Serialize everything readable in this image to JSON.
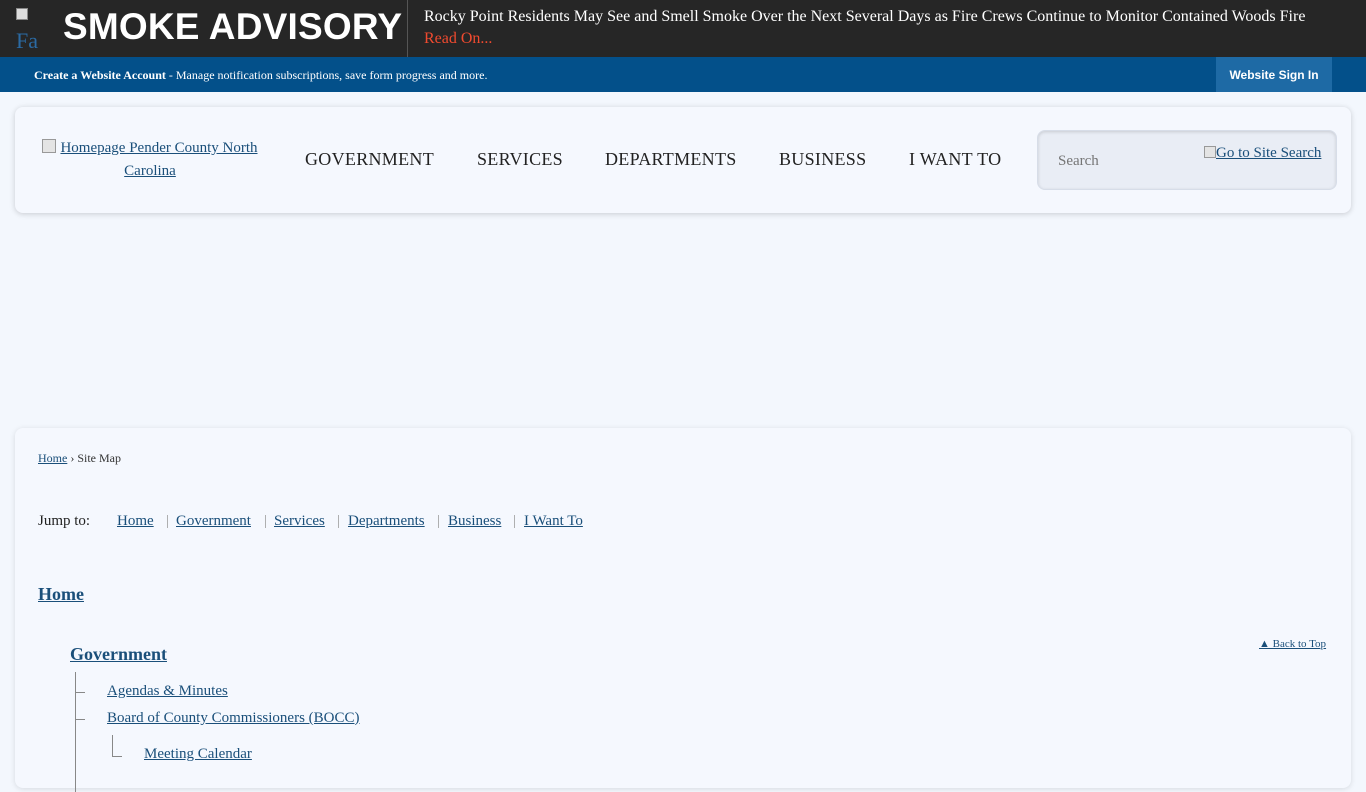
{
  "alert": {
    "icon": "alert-image-icon",
    "icon_alt": "Fa",
    "title": "SMOKE ADVISORY",
    "headline": "Rocky Point Residents May See and Smell Smoke Over the Next Several Days as Fire Crews Continue to Monitor Contained Woods Fire",
    "read_on": "Read On..."
  },
  "account_bar": {
    "create_label": "Create a Website Account",
    "create_desc": " - Manage notification subscriptions, save form progress and more.",
    "signin_label": "Website Sign In"
  },
  "header": {
    "logo_text": "Homepage Pender County North Carolina",
    "nav": [
      "GOVERNMENT",
      "SERVICES",
      "DEPARTMENTS",
      "BUSINESS",
      "I WANT TO"
    ],
    "search_placeholder": "Search",
    "search_button": "Go to Site Search"
  },
  "breadcrumb": {
    "home": "Home",
    "sep": " › ",
    "current": "Site Map"
  },
  "jump": {
    "label": "Jump to:",
    "links": [
      "Home",
      "Government",
      "Services",
      "Departments",
      "Business",
      "I Want To"
    ]
  },
  "sitemap": {
    "home": "Home",
    "government": "Government",
    "back_to_top": "▲ Back to Top",
    "items": [
      "Agendas & Minutes",
      "Board of County Commissioners (BOCC)"
    ],
    "subitems": [
      "Meeting Calendar"
    ]
  },
  "colors": {
    "alert_bg": "#262626",
    "account_bg": "#03508a",
    "signin_bg": "#1e6aa5",
    "read_on": "#f04a2f",
    "link": "#1a4f7a"
  }
}
